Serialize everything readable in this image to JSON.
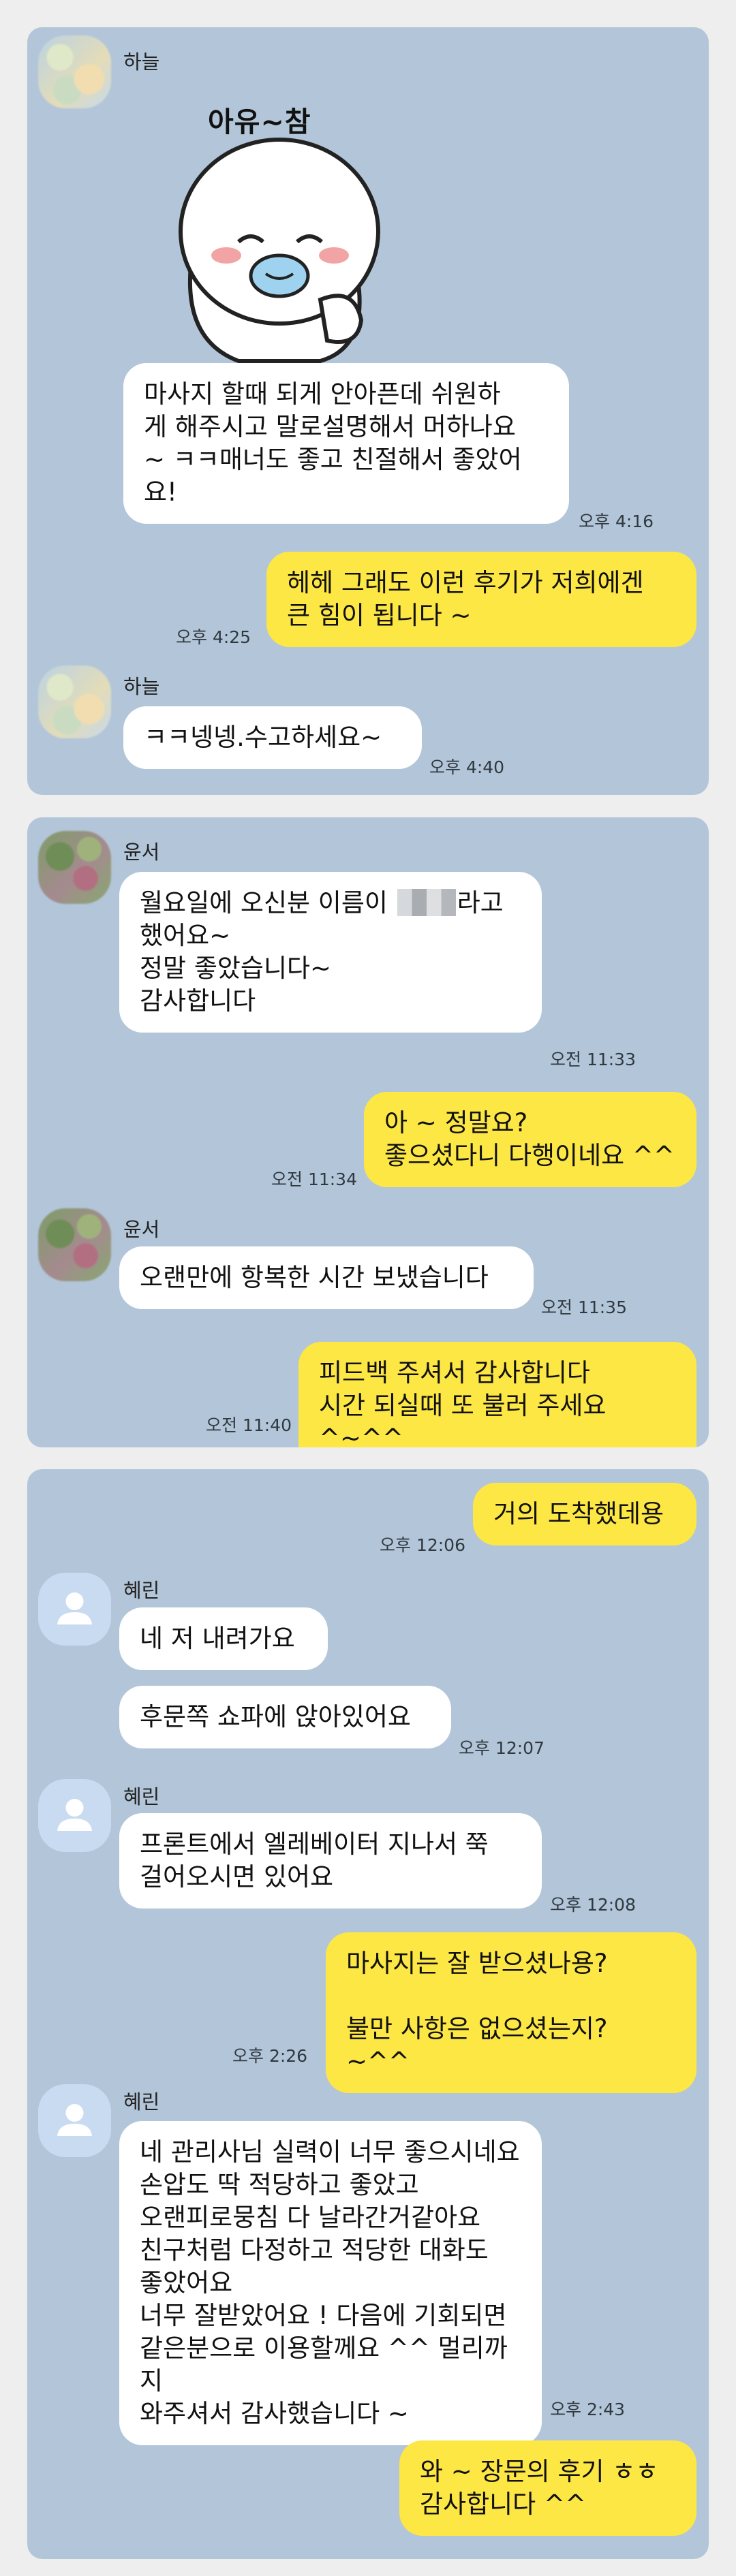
{
  "panels": [
    {
      "messages": [
        {
          "sender": "하늘",
          "sticker_caption": "아유~참"
        },
        {
          "text": "마사지 할때 되게 안아픈데 쉬원하\n게 해주시고 말로설명해서 머하나요\n~ ㅋㅋ매너도 좋고 친절해서 좋았어\n요!",
          "time": "오후 4:16"
        },
        {
          "text": "헤헤 그래도 이런 후기가 저희에겐\n큰 힘이 됩니다 ~",
          "time": "오후 4:25"
        },
        {
          "sender": "하늘",
          "text": "ㅋㅋ넹넹.수고하세요~",
          "time": "오후 4:40"
        }
      ]
    },
    {
      "messages": [
        {
          "sender": "윤서",
          "text_before": "월요일에 오신분 이름이 ",
          "text_after": "라고",
          "text_rest": "했어요~\n정말 좋았습니다~\n감사합니다",
          "time": "오전 11:33"
        },
        {
          "text": "아 ~ 정말요?\n좋으셨다니 다행이네요 ^^",
          "time": "오전 11:34"
        },
        {
          "sender": "윤서",
          "text": "오랜만에 항복한 시간 보냈습니다",
          "time": "오전 11:35"
        },
        {
          "text": "피드백 주셔서 감사합니다\n시간 되실때 또 불러 주세요 ^~^^",
          "time": "오전 11:40"
        }
      ]
    },
    {
      "messages": [
        {
          "text": "거의 도착했데용",
          "time": "오후 12:06"
        },
        {
          "sender": "혜린",
          "text": "네 저 내려가요"
        },
        {
          "text": "후문쪽 쇼파에 앉아있어요",
          "time": "오후 12:07"
        },
        {
          "sender": "혜린",
          "text": "프론트에서 엘레베이터 지나서 쭉\n걸어오시면 있어요",
          "time": "오후 12:08"
        },
        {
          "text": "마사지는 잘 받으셨나용?\n\n불만 사항은 없으셨는지? ~^^",
          "time": "오후 2:26"
        },
        {
          "sender": "혜린",
          "text": "네 관리사님 실력이 너무 좋으시네요\n손압도 딱 적당하고 좋았고\n오랜피로뭉침 다 날라간거같아요\n친구처럼 다정하고 적당한 대화도\n좋았어요\n너무 잘받았어요 ! 다음에 기회되면\n같은분으로 이용할께요 ^^ 멀리까지\n와주셔서 감사했습니다 ~",
          "time": "오후 2:43"
        },
        {
          "text": "와 ~ 장문의 후기 ㅎㅎ\n감사합니다 ^^"
        }
      ]
    }
  ],
  "colors": {
    "chat_background": "#b3c6d9",
    "outgoing_bubble": "#fde744",
    "incoming_bubble": "#ffffff",
    "page_background": "#eeeeee"
  },
  "icons": [
    "sticker-character",
    "default-profile-icon"
  ]
}
